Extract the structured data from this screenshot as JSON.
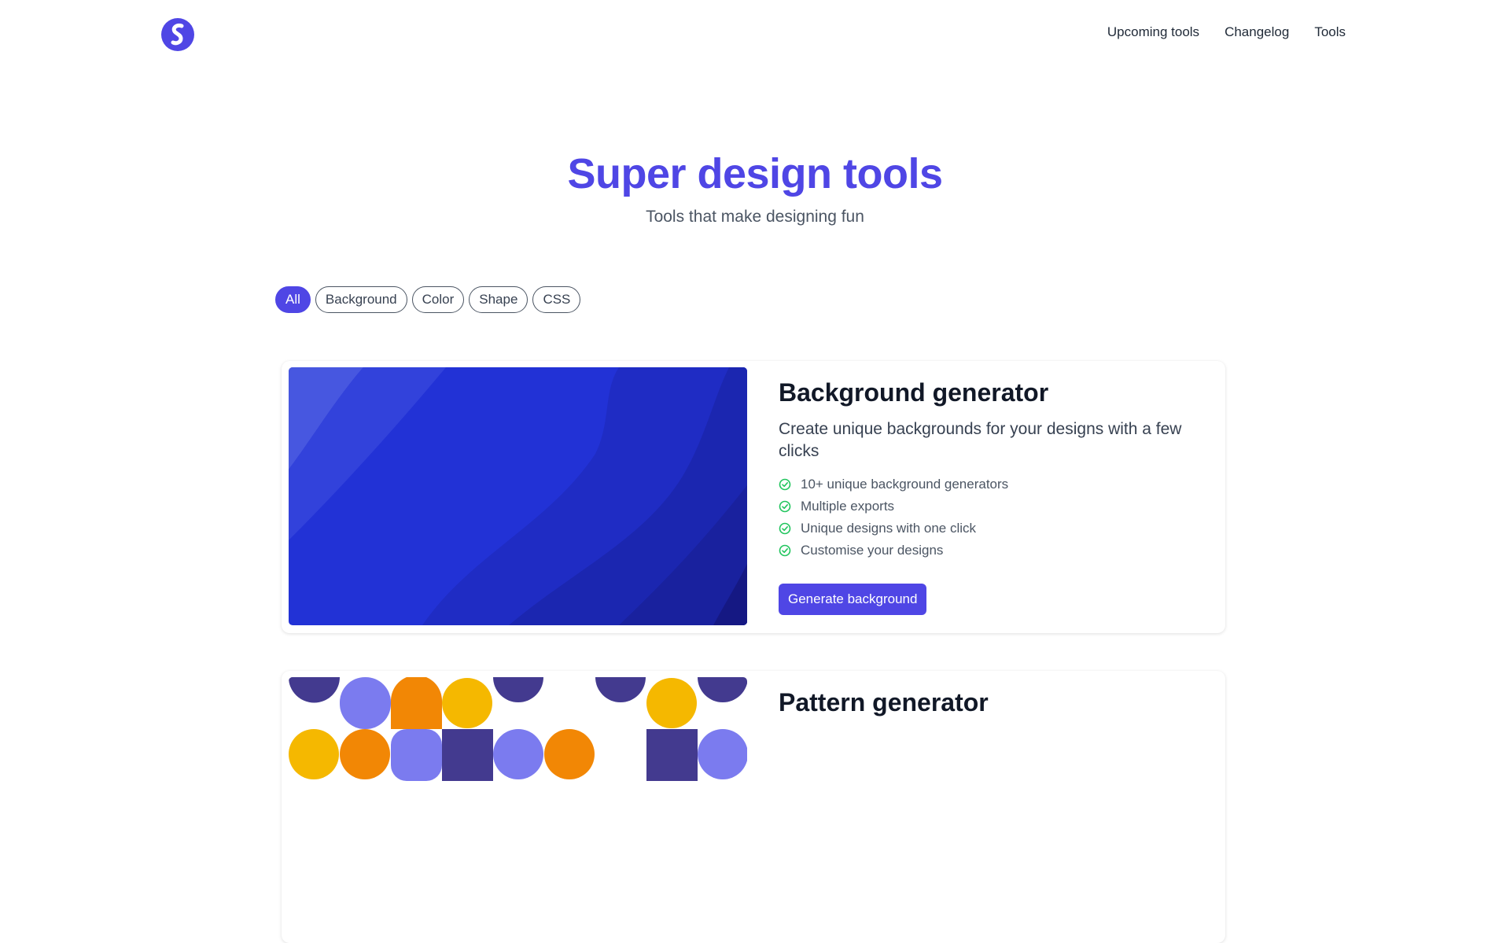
{
  "nav": {
    "logo_glyph": "S",
    "links": [
      "Upcoming tools",
      "Changelog",
      "Tools"
    ]
  },
  "hero": {
    "title": "Super design tools",
    "subtitle": "Tools that make designing fun"
  },
  "filters": {
    "items": [
      "All",
      "Background",
      "Color",
      "Shape",
      "CSS"
    ],
    "active": "All"
  },
  "cards": [
    {
      "title": "Background generator",
      "description": "Create unique backgrounds for your designs with a few clicks",
      "features": [
        "10+ unique background generators",
        "Multiple exports",
        "Unique designs with one click",
        "Customise your designs"
      ],
      "button": "Generate background"
    },
    {
      "title": "Pattern generator"
    }
  ],
  "colors": {
    "accent": "#4f46e5",
    "check": "#22c55e",
    "pattern_purple": "#433a8f",
    "pattern_lavender": "#7b7bef",
    "pattern_orange": "#f28705",
    "pattern_yellow": "#f5b800"
  }
}
